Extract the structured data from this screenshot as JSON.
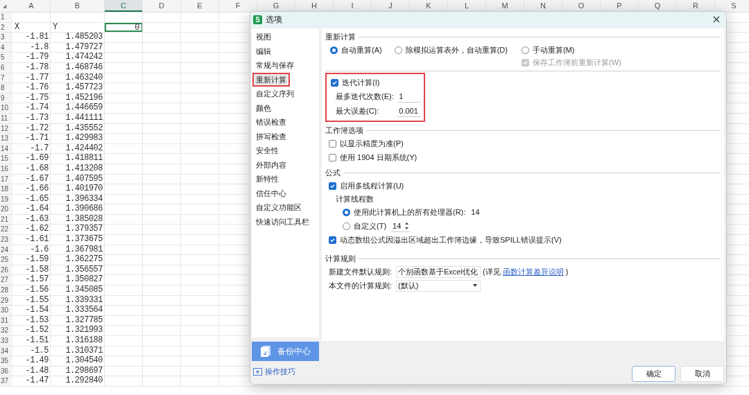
{
  "sheet": {
    "corner": "◢",
    "columns": [
      {
        "label": "A",
        "selected": false
      },
      {
        "label": "B",
        "selected": false
      },
      {
        "label": "C",
        "selected": true
      },
      {
        "label": "D",
        "selected": false
      },
      {
        "label": "E",
        "selected": false
      },
      {
        "label": "F",
        "selected": false
      },
      {
        "label": "G",
        "selected": false
      },
      {
        "label": "H",
        "selected": false
      },
      {
        "label": "I",
        "selected": false
      },
      {
        "label": "J",
        "selected": false
      },
      {
        "label": "K",
        "selected": false
      },
      {
        "label": "L",
        "selected": false
      },
      {
        "label": "M",
        "selected": false
      },
      {
        "label": "N",
        "selected": false
      },
      {
        "label": "O",
        "selected": false
      },
      {
        "label": "P",
        "selected": false
      },
      {
        "label": "Q",
        "selected": false
      },
      {
        "label": "R",
        "selected": false
      },
      {
        "label": "S",
        "selected": false
      }
    ],
    "rows": [
      {
        "num": "1",
        "cells": []
      },
      {
        "num": "2",
        "cells": [
          {
            "text": "X",
            "kind": "text",
            "selected": false
          },
          {
            "text": "Y",
            "kind": "text",
            "selected": false
          },
          {
            "text": "0",
            "kind": "number",
            "selected": true
          }
        ]
      },
      {
        "num": "3",
        "cells": [
          {
            "text": "-1.81"
          },
          {
            "text": "1.485203"
          }
        ]
      },
      {
        "num": "4",
        "cells": [
          {
            "text": "-1.8"
          },
          {
            "text": "1.479727"
          }
        ]
      },
      {
        "num": "5",
        "cells": [
          {
            "text": "-1.79"
          },
          {
            "text": "1.474242"
          }
        ]
      },
      {
        "num": "6",
        "cells": [
          {
            "text": "-1.78"
          },
          {
            "text": "1.468746"
          }
        ]
      },
      {
        "num": "7",
        "cells": [
          {
            "text": "-1.77"
          },
          {
            "text": "1.463240"
          }
        ]
      },
      {
        "num": "8",
        "cells": [
          {
            "text": "-1.76"
          },
          {
            "text": "1.457723"
          }
        ]
      },
      {
        "num": "9",
        "cells": [
          {
            "text": "-1.75"
          },
          {
            "text": "1.452196"
          }
        ]
      },
      {
        "num": "10",
        "cells": [
          {
            "text": "-1.74"
          },
          {
            "text": "1.446659"
          }
        ]
      },
      {
        "num": "11",
        "cells": [
          {
            "text": "-1.73"
          },
          {
            "text": "1.441111"
          }
        ]
      },
      {
        "num": "12",
        "cells": [
          {
            "text": "-1.72"
          },
          {
            "text": "1.435552"
          }
        ]
      },
      {
        "num": "13",
        "cells": [
          {
            "text": "-1.71"
          },
          {
            "text": "1.429983"
          }
        ]
      },
      {
        "num": "14",
        "cells": [
          {
            "text": "-1.7"
          },
          {
            "text": "1.424402"
          }
        ]
      },
      {
        "num": "15",
        "cells": [
          {
            "text": "-1.69"
          },
          {
            "text": "1.418811"
          }
        ]
      },
      {
        "num": "16",
        "cells": [
          {
            "text": "-1.68"
          },
          {
            "text": "1.413208"
          }
        ]
      },
      {
        "num": "17",
        "cells": [
          {
            "text": "-1.67"
          },
          {
            "text": "1.407595"
          }
        ]
      },
      {
        "num": "18",
        "cells": [
          {
            "text": "-1.66"
          },
          {
            "text": "1.401970"
          }
        ]
      },
      {
        "num": "19",
        "cells": [
          {
            "text": "-1.65"
          },
          {
            "text": "1.396334"
          }
        ]
      },
      {
        "num": "20",
        "cells": [
          {
            "text": "-1.64"
          },
          {
            "text": "1.390686"
          }
        ]
      },
      {
        "num": "21",
        "cells": [
          {
            "text": "-1.63"
          },
          {
            "text": "1.385028"
          }
        ]
      },
      {
        "num": "22",
        "cells": [
          {
            "text": "-1.62"
          },
          {
            "text": "1.379357"
          }
        ]
      },
      {
        "num": "23",
        "cells": [
          {
            "text": "-1.61"
          },
          {
            "text": "1.373675"
          }
        ]
      },
      {
        "num": "24",
        "cells": [
          {
            "text": "-1.6"
          },
          {
            "text": "1.367981"
          }
        ]
      },
      {
        "num": "25",
        "cells": [
          {
            "text": "-1.59"
          },
          {
            "text": "1.362275"
          }
        ]
      },
      {
        "num": "26",
        "cells": [
          {
            "text": "-1.58"
          },
          {
            "text": "1.356557"
          }
        ]
      },
      {
        "num": "27",
        "cells": [
          {
            "text": "-1.57"
          },
          {
            "text": "1.350827"
          }
        ]
      },
      {
        "num": "28",
        "cells": [
          {
            "text": "-1.56"
          },
          {
            "text": "1.345085"
          }
        ]
      },
      {
        "num": "29",
        "cells": [
          {
            "text": "-1.55"
          },
          {
            "text": "1.339331"
          }
        ]
      },
      {
        "num": "30",
        "cells": [
          {
            "text": "-1.54"
          },
          {
            "text": "1.333564"
          }
        ]
      },
      {
        "num": "31",
        "cells": [
          {
            "text": "-1.53"
          },
          {
            "text": "1.327785"
          }
        ]
      },
      {
        "num": "32",
        "cells": [
          {
            "text": "-1.52"
          },
          {
            "text": "1.321993"
          }
        ]
      },
      {
        "num": "33",
        "cells": [
          {
            "text": "-1.51"
          },
          {
            "text": "1.316188"
          }
        ]
      },
      {
        "num": "34",
        "cells": [
          {
            "text": "-1.5"
          },
          {
            "text": "1.310371"
          }
        ]
      },
      {
        "num": "35",
        "cells": [
          {
            "text": "-1.49"
          },
          {
            "text": "1.304540"
          }
        ]
      },
      {
        "num": "36",
        "cells": [
          {
            "text": "-1.48"
          },
          {
            "text": "1.298697"
          }
        ]
      },
      {
        "num": "37",
        "cells": [
          {
            "text": "-1.47"
          },
          {
            "text": "1.292840"
          }
        ]
      }
    ]
  },
  "dialog": {
    "logo": "S",
    "title": "选项",
    "nav": [
      {
        "label": "视图",
        "selected": false
      },
      {
        "label": "编辑",
        "selected": false
      },
      {
        "label": "常规与保存",
        "selected": false
      },
      {
        "label": "重新计算",
        "selected": true
      },
      {
        "label": "自定义序列",
        "selected": false
      },
      {
        "label": "颜色",
        "selected": false
      },
      {
        "label": "错误检查",
        "selected": false
      },
      {
        "label": "拼写检查",
        "selected": false
      },
      {
        "label": "安全性",
        "selected": false
      },
      {
        "label": "外部内容",
        "selected": false
      },
      {
        "label": "新特性",
        "selected": false
      },
      {
        "label": "信任中心",
        "selected": false
      },
      {
        "label": "自定义功能区",
        "selected": false
      },
      {
        "label": "快速访问工具栏",
        "selected": false
      }
    ],
    "backup": "备份中心",
    "tips": "操作技巧",
    "recalc": {
      "title": "重新计算",
      "modes": [
        {
          "label": "自动重算(A)",
          "selected": true
        },
        {
          "label": "除模拟运算表外，自动重算(D)",
          "selected": false
        },
        {
          "label": "手动重算(M)",
          "selected": false
        }
      ],
      "save_before": {
        "label": "保存工作簿前重新计算(W)",
        "checked": true,
        "disabled": true
      }
    },
    "iteration": {
      "highlighted": true,
      "enabled": {
        "label": "迭代计算(I)",
        "checked": true
      },
      "fields": [
        {
          "label": "最多迭代次数(E):",
          "value": "1"
        },
        {
          "label": "最大误差(C):",
          "value": "0.001"
        }
      ]
    },
    "workbook": {
      "title": "工作簿选项",
      "options": [
        {
          "label": "以显示精度为准(P)",
          "checked": false
        },
        {
          "label": "使用 1904 日期系统(Y)",
          "checked": false
        }
      ]
    },
    "formula": {
      "title": "公式",
      "multithread": {
        "label": "启用多线程计算(U)",
        "checked": true
      },
      "threads_label": "计算线程数",
      "thread_modes": [
        {
          "kind": "text",
          "label": "使用此计算机上的所有处理器(R):",
          "value": "14",
          "selected": true
        },
        {
          "kind": "spinner",
          "label": "自定义(T)",
          "value": "14",
          "selected": false
        }
      ],
      "spill": {
        "label": "动态数组公式因溢出区域超出工作簿边缘，导致SPILL错误提示(V)",
        "checked": true
      }
    },
    "rules": {
      "title": "计算规则",
      "rows": [
        {
          "label": "新建文件默认规则:",
          "value": "个别函数基于Excel优化",
          "note": "(详见",
          "link": "函数计算差异说明",
          "close": ")"
        },
        {
          "label": "本文件的计算规则:",
          "value": "(默认)"
        }
      ]
    },
    "buttons": [
      {
        "label": "确定",
        "primary": true
      },
      {
        "label": "取消",
        "primary": false
      }
    ]
  }
}
